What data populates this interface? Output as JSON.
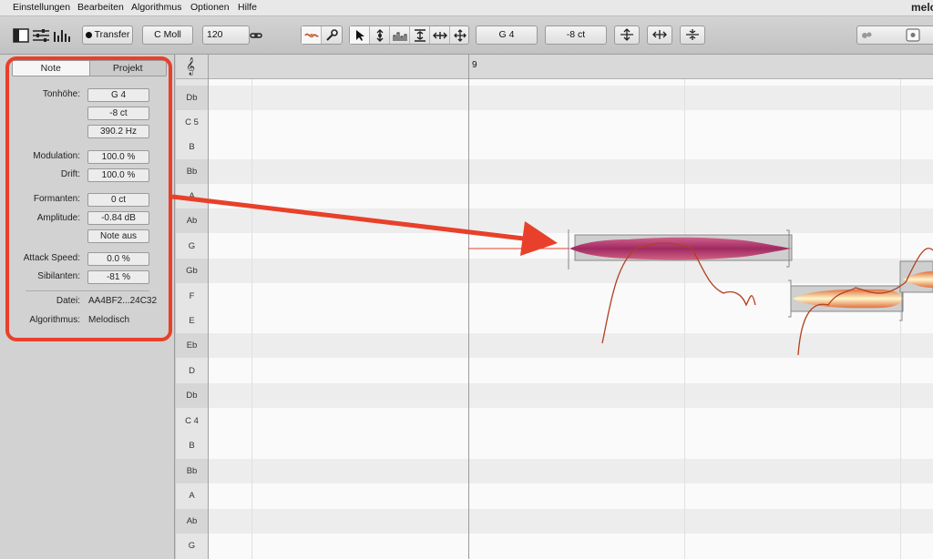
{
  "menu": {
    "items": [
      "Einstellungen",
      "Bearbeiten",
      "Algorithmus",
      "Optionen",
      "Hilfe"
    ],
    "app_name": "melo"
  },
  "toolbar": {
    "transfer_label": "Transfer",
    "key_label": "C Moll",
    "tempo": "120",
    "pitch_readout": "G 4",
    "cents_readout": "-8 ct",
    "icons": [
      "panel-toggle-icon",
      "mixer-sliders-icon",
      "level-bars-icon",
      "link-icon",
      "main-tool-icon",
      "wrench-icon",
      "pointer-tool-icon",
      "pitch-tool-icon",
      "formant-tool-icon",
      "amplitude-tool-icon",
      "time-tool-icon",
      "move-tool-icon",
      "quantize-pitch-icon",
      "quantize-time-icon",
      "snap-icon",
      "zoom-slider-icon"
    ]
  },
  "inspector": {
    "tabs": [
      "Note",
      "Projekt"
    ],
    "active_tab": "Note",
    "pitch_label": "Tonhöhe:",
    "pitch_note": "G 4",
    "pitch_cents": "-8 ct",
    "pitch_hz": "390.2 Hz",
    "modulation_label": "Modulation:",
    "modulation_value": "100.0 %",
    "drift_label": "Drift:",
    "drift_value": "100.0 %",
    "formants_label": "Formanten:",
    "formants_value": "0 ct",
    "amplitude_label": "Amplitude:",
    "amplitude_value": "-0.84 dB",
    "note_off_label": "Note aus",
    "attack_label": "Attack Speed:",
    "attack_value": "0.0 %",
    "sibilants_label": "Sibilanten:",
    "sibilants_value": "-81 %",
    "file_label": "Datei:",
    "file_value": "AA4BF2...24C32",
    "algorithm_label": "Algorithmus:",
    "algorithm_value": "Melodisch"
  },
  "keys": [
    "Db",
    "C 5",
    "B",
    "Bb",
    "A",
    "Ab",
    "G",
    "Gb",
    "F",
    "E",
    "Eb",
    "D",
    "Db",
    "C 4",
    "B",
    "Bb",
    "A",
    "Ab",
    "G"
  ],
  "ruler": {
    "bar_label": "9"
  },
  "colors": {
    "highlight_red": "#e8402a",
    "blob_magenta": "#b0306a",
    "blob_gold": "#f0d070",
    "pitch_curve": "#b34020"
  }
}
